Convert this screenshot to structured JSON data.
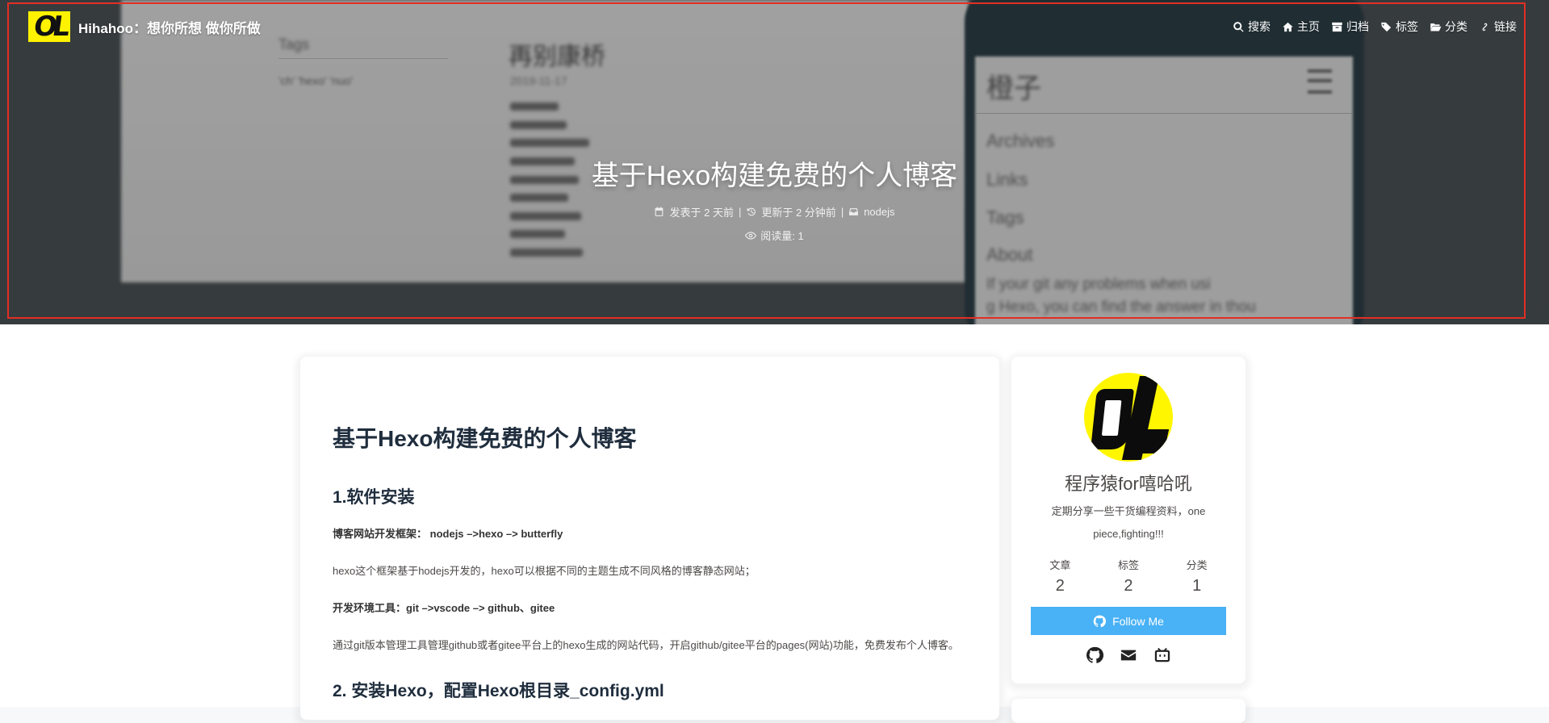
{
  "site": {
    "name": "Hihahoo：想你所想 做你所做",
    "logo_text": "OL"
  },
  "nav": {
    "items": [
      {
        "label": "搜索",
        "icon": "search-icon"
      },
      {
        "label": "主页",
        "icon": "home-icon"
      },
      {
        "label": "归档",
        "icon": "archive-icon"
      },
      {
        "label": "标签",
        "icon": "tags-icon"
      },
      {
        "label": "分类",
        "icon": "folder-open-icon"
      },
      {
        "label": "链接",
        "icon": "link-icon"
      }
    ]
  },
  "hero": {
    "background": {
      "blog_title": "再别康桥",
      "blog_date": "2019-11-17",
      "tags_title": "Tags",
      "tags_list": "'ch' 'hexo' 'nuo'",
      "phone_title": "橙子",
      "phone_items": [
        "Archives",
        "Links",
        "Tags",
        "About"
      ],
      "phone_text_1": "If your git any problems when usi",
      "phone_text_2": "g Hexo, you can find the answer in thou"
    },
    "title": "基于Hexo构建免费的个人博客",
    "meta": {
      "posted": "发表于 2 天前",
      "updated": "更新于 2 分钟前",
      "category": "nodejs",
      "separator": "|",
      "views": "阅读量: 1"
    }
  },
  "article": {
    "h1": "基于Hexo构建免费的个人博客",
    "section1_title": "1.软件安装",
    "p1_label": "博客网站开发框架：",
    "p1_value": "nodejs –>hexo –> butterfly",
    "p2": "hexo这个框架基于hodejs开发的，hexo可以根据不同的主题生成不同风格的博客静态网站；",
    "p3_label": "开发环境工具：",
    "p3_value": "git –>vscode –> github、gitee",
    "p4": "通过git版本管理工具管理github或者gitee平台上的hexo生成的网站代码，开启github/gitee平台的pages(网站)功能，免费发布个人博客。",
    "section2_title": "2. 安装Hexo，配置Hexo根目录_config.yml"
  },
  "profile": {
    "name": "程序猿for嘻哈吼",
    "description": "定期分享一些干货编程资料，one piece,fighting!!!",
    "stats": [
      {
        "label": "文章",
        "value": "2"
      },
      {
        "label": "标签",
        "value": "2"
      },
      {
        "label": "分类",
        "value": "1"
      }
    ],
    "follow_label": "Follow Me",
    "social": [
      "github-icon",
      "email-icon",
      "bilibili-icon"
    ]
  },
  "colors": {
    "accent": "#49b1f5",
    "highlight_border": "#e32f24",
    "logo_yellow": "#fff200"
  }
}
